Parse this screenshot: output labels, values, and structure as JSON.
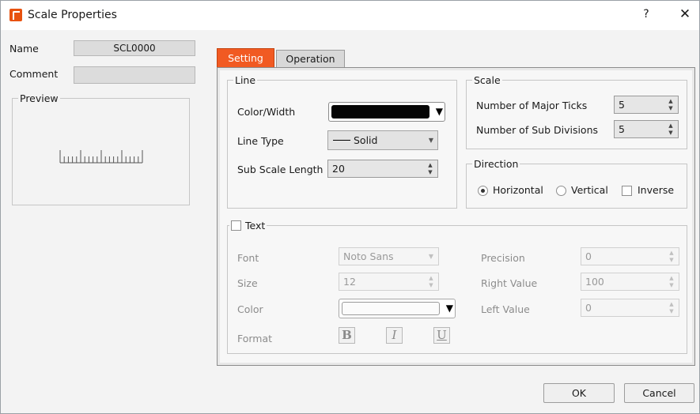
{
  "window": {
    "title": "Scale Properties",
    "help": "?",
    "close": "✕"
  },
  "left": {
    "name_label": "Name",
    "name_value": "SCL0000",
    "comment_label": "Comment",
    "comment_value": "",
    "preview_label": "Preview"
  },
  "tabs": [
    {
      "label": "Setting",
      "active": true
    },
    {
      "label": "Operation",
      "active": false
    }
  ],
  "line": {
    "legend": "Line",
    "color_width_label": "Color/Width",
    "color_value": "#000000",
    "line_type_label": "Line Type",
    "line_type_value": "Solid",
    "sub_scale_label": "Sub Scale Length",
    "sub_scale_value": "20"
  },
  "scale": {
    "legend": "Scale",
    "major_ticks_label": "Number of Major Ticks",
    "major_ticks_value": "5",
    "sub_divisions_label": "Number of Sub Divisions",
    "sub_divisions_value": "5"
  },
  "direction": {
    "legend": "Direction",
    "horizontal_label": "Horizontal",
    "vertical_label": "Vertical",
    "inverse_label": "Inverse",
    "selected": "Horizontal",
    "inverse_checked": false
  },
  "text": {
    "legend": "Text",
    "enabled": false,
    "font_label": "Font",
    "font_value": "Noto Sans",
    "size_label": "Size",
    "size_value": "12",
    "color_label": "Color",
    "format_label": "Format",
    "bold_glyph": "B",
    "italic_glyph": "I",
    "underline_glyph": "U",
    "precision_label": "Precision",
    "precision_value": "0",
    "right_value_label": "Right Value",
    "right_value": "100",
    "left_value_label": "Left Value",
    "left_value": "0"
  },
  "buttons": {
    "ok": "OK",
    "cancel": "Cancel"
  },
  "colors": {
    "accent": "#f15a22",
    "line_color": "#000000"
  }
}
